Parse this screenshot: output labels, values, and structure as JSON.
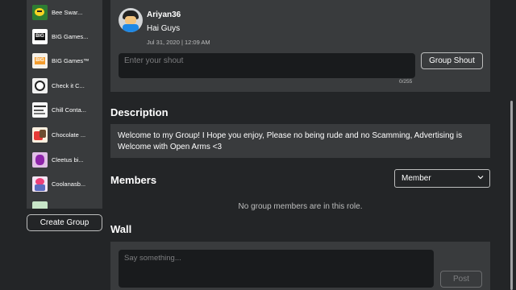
{
  "sidebar": {
    "groups": [
      {
        "name": "Bee Swar...",
        "thumb": "bee"
      },
      {
        "name": "BIG Games...",
        "thumb": "big"
      },
      {
        "name": "BIG Games™",
        "thumb": "big-orange"
      },
      {
        "name": "Check it C...",
        "thumb": "check"
      },
      {
        "name": "Chill Conta...",
        "thumb": "chill"
      },
      {
        "name": "Chocolate ...",
        "thumb": "chocolate"
      },
      {
        "name": "Cleetus bi...",
        "thumb": "cleetus"
      },
      {
        "name": "Coolanasb...",
        "thumb": "coolanasb"
      },
      {
        "name": "",
        "thumb": "partial"
      }
    ],
    "create_group_label": "Create Group"
  },
  "shout": {
    "user": "Ariyan36",
    "text": "Hai Guys",
    "date": "Jul 31, 2020 | 12:09 AM",
    "input_placeholder": "Enter your shout",
    "char_count": "0/255",
    "button_label": "Group Shout"
  },
  "description": {
    "title": "Description",
    "text": "Welcome to my Group! I Hope you enjoy, Please no being rude and no Scamming, Advertising is Welcome with Open Arms <3"
  },
  "members": {
    "title": "Members",
    "role_selected": "Member",
    "empty_text": "No group members are in this role."
  },
  "wall": {
    "title": "Wall",
    "input_placeholder": "Say something...",
    "post_label": "Post"
  },
  "colors": {
    "background": "#232527",
    "card": "#393b3d",
    "input": "#191b1d",
    "muted_text": "#bdbebe"
  }
}
